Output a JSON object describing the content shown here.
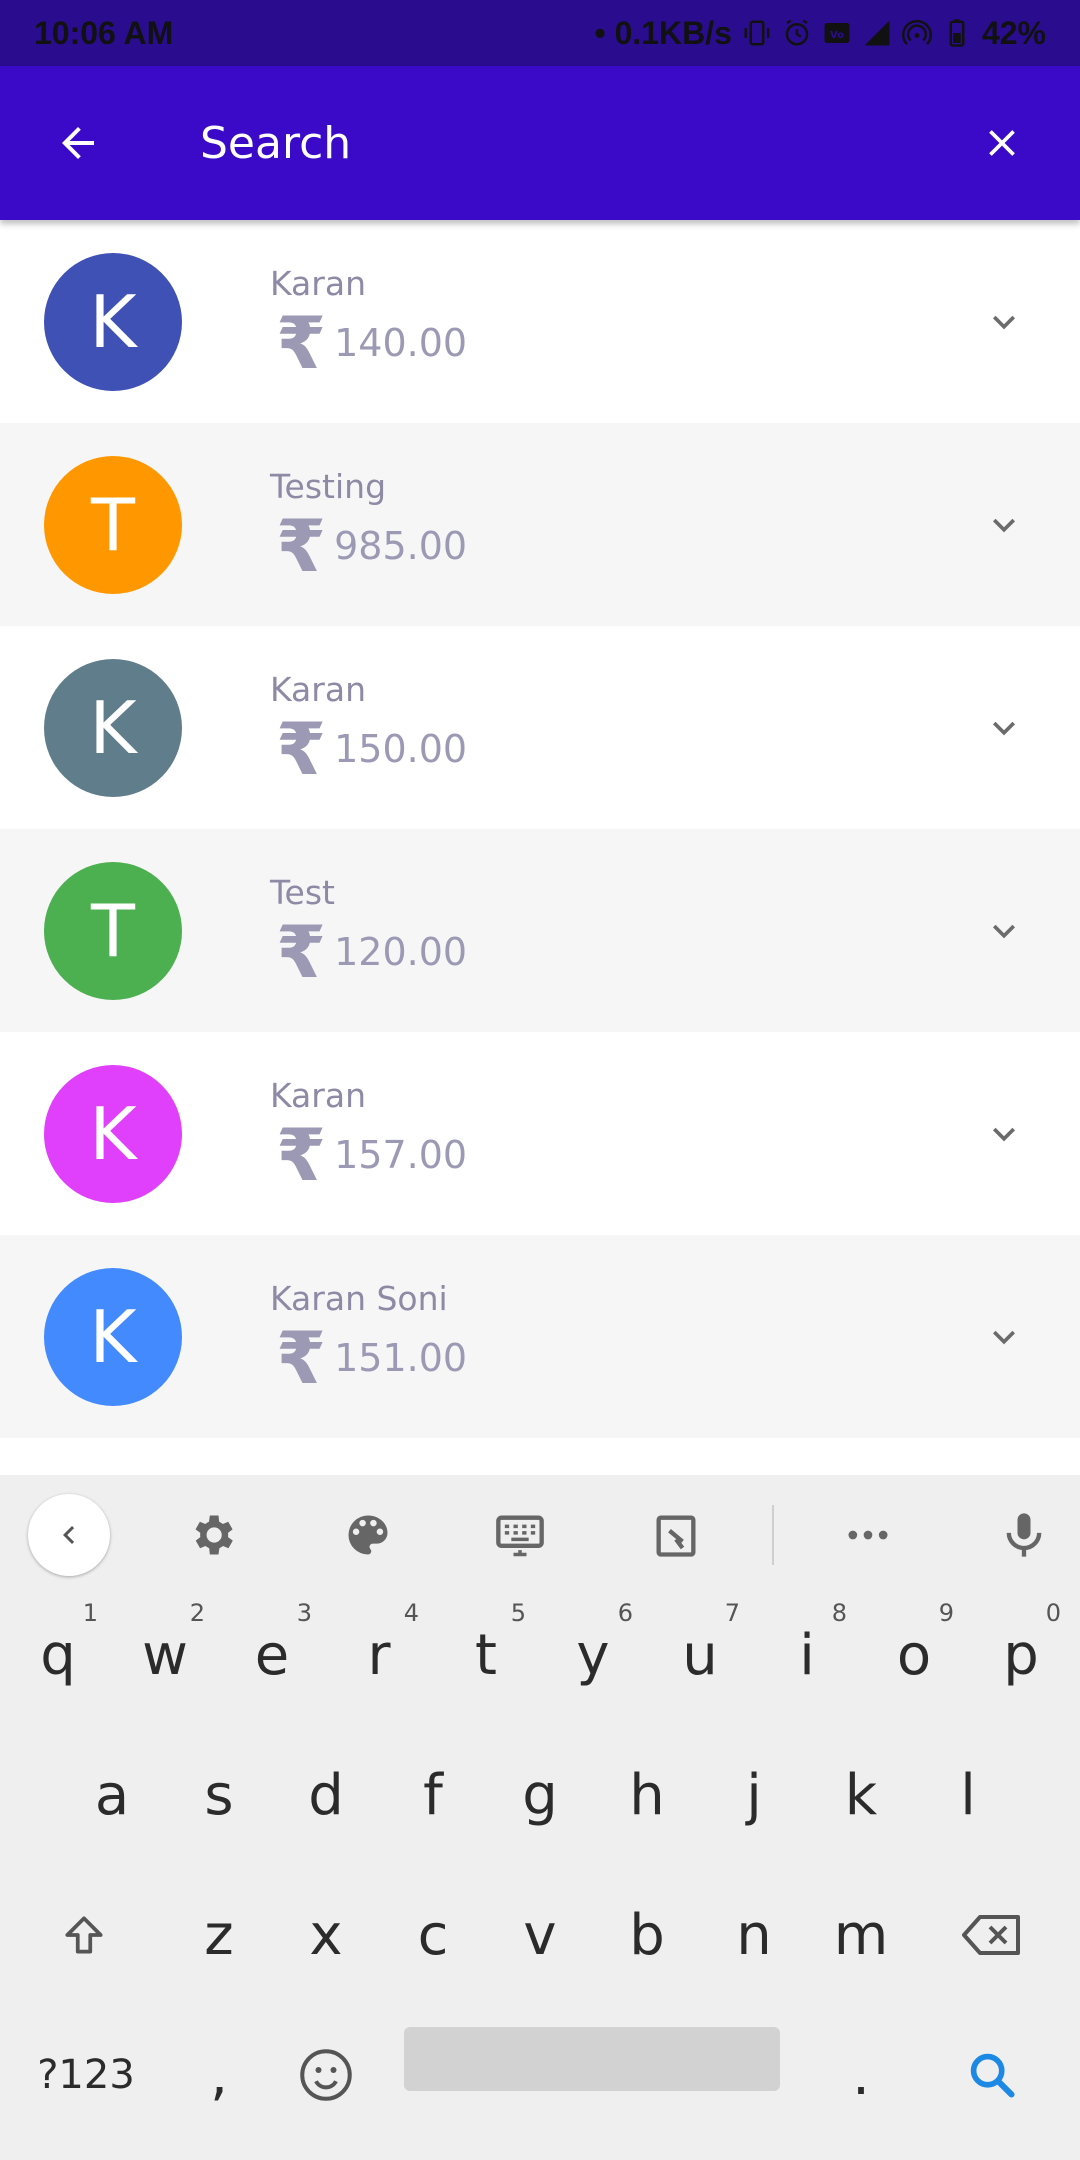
{
  "status_bar": {
    "time": "10:06 AM",
    "network_speed": "• 0.1KB/s",
    "battery": "42%",
    "icons": [
      "vibrate-icon",
      "alarm-icon",
      "volte-icon",
      "signal-4g-icon",
      "hotspot-icon",
      "battery-icon"
    ]
  },
  "app_bar": {
    "search_placeholder": "Search",
    "back_icon": "arrow-back-icon",
    "clear_icon": "close-icon"
  },
  "colors": {
    "status_bar": "#2a0d8f",
    "app_bar": "#3a0ac8"
  },
  "items": [
    {
      "initial": "K",
      "name": "Karan",
      "amount": "140.00",
      "color": "#3f51b5"
    },
    {
      "initial": "T",
      "name": "Testing",
      "amount": "985.00",
      "color": "#ff9800"
    },
    {
      "initial": "K",
      "name": "Karan",
      "amount": "150.00",
      "color": "#607d8b"
    },
    {
      "initial": "T",
      "name": "Test",
      "amount": "120.00",
      "color": "#4caf50"
    },
    {
      "initial": "K",
      "name": "Karan",
      "amount": "157.00",
      "color": "#e040fb"
    },
    {
      "initial": "K",
      "name": "Karan Soni",
      "amount": "151.00",
      "color": "#448aff"
    }
  ],
  "currency_symbol": "₹",
  "keyboard": {
    "toolbar_icons": [
      "chevron-left-icon",
      "gear-icon",
      "palette-icon",
      "keyboard-icon",
      "clipboard-icon",
      "more-icon",
      "mic-icon"
    ],
    "row1": [
      {
        "k": "q",
        "h": "1"
      },
      {
        "k": "w",
        "h": "2"
      },
      {
        "k": "e",
        "h": "3"
      },
      {
        "k": "r",
        "h": "4"
      },
      {
        "k": "t",
        "h": "5"
      },
      {
        "k": "y",
        "h": "6"
      },
      {
        "k": "u",
        "h": "7"
      },
      {
        "k": "i",
        "h": "8"
      },
      {
        "k": "o",
        "h": "9"
      },
      {
        "k": "p",
        "h": "0"
      }
    ],
    "row2": [
      "a",
      "s",
      "d",
      "f",
      "g",
      "h",
      "j",
      "k",
      "l"
    ],
    "row3": [
      "z",
      "x",
      "c",
      "v",
      "b",
      "n",
      "m"
    ],
    "symbols_label": "?123",
    "comma_label": ",",
    "period_label": "."
  }
}
